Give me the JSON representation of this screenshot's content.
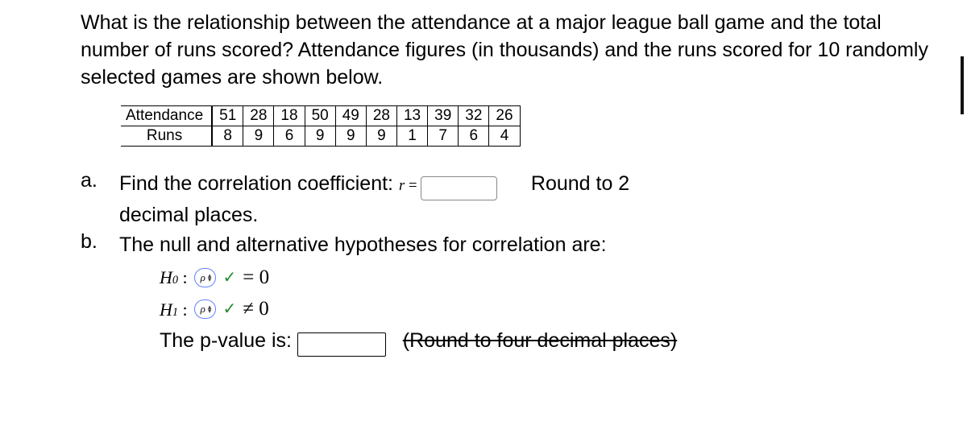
{
  "prompt_text": "What is the relationship between the attendance at a major league ball game and the total number of runs scored? Attendance figures (in thousands) and the runs scored for 10 randomly selected games are shown below.",
  "table": {
    "row1_label": "Attendance",
    "row2_label": "Runs",
    "attendance": [
      "51",
      "28",
      "18",
      "50",
      "49",
      "28",
      "13",
      "39",
      "32",
      "26"
    ],
    "runs": [
      "8",
      "9",
      "6",
      "9",
      "9",
      "9",
      "1",
      "7",
      "6",
      "4"
    ]
  },
  "qa": {
    "marker": "a.",
    "text_before": "Find the correlation coefficient: ",
    "r_sym": "r",
    "eq_sym": " = ",
    "text_after1": "Round to 2",
    "text_after2": "decimal places."
  },
  "qb": {
    "marker": "b.",
    "intro": "The null and alternative hypotheses for correlation are:",
    "H0_label": "H",
    "H0_sub": "0",
    "H1_label": "H",
    "H1_sub": "1",
    "colon": ":",
    "dd_value": "ρ",
    "eq0": "=  0",
    "neq0": "≠  0",
    "pval_text": "The p-value is: ",
    "round_hint": "(Round to four decimal places)"
  },
  "chart_data": {
    "type": "table",
    "title": "Attendance vs Runs for 10 games",
    "series": [
      {
        "name": "Attendance (thousands)",
        "values": [
          51,
          28,
          18,
          50,
          49,
          28,
          13,
          39,
          32,
          26
        ]
      },
      {
        "name": "Runs",
        "values": [
          8,
          9,
          6,
          9,
          9,
          9,
          1,
          7,
          6,
          4
        ]
      }
    ]
  }
}
